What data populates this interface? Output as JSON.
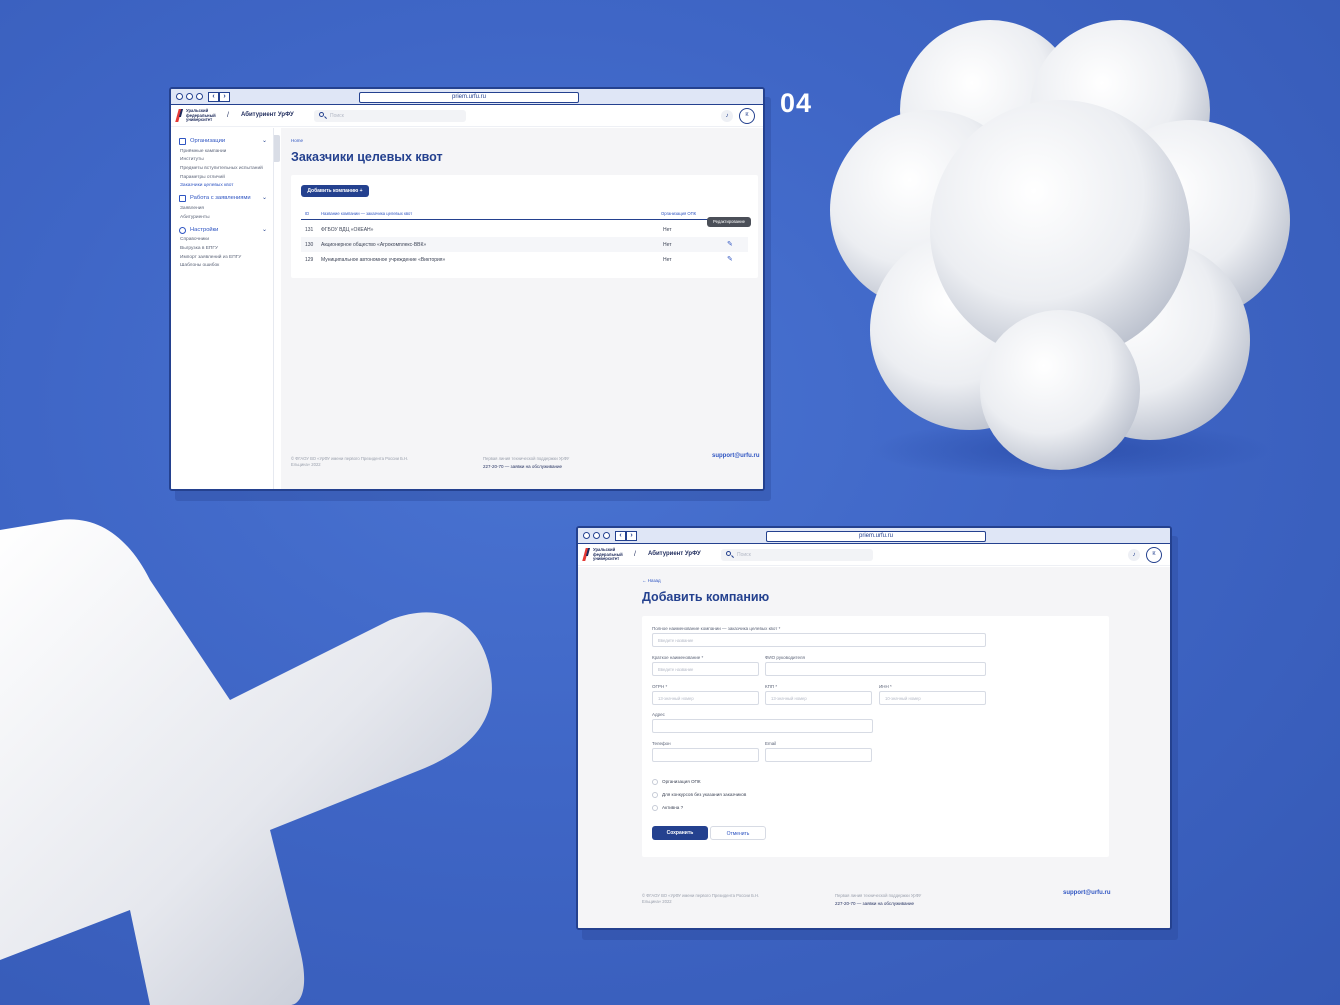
{
  "step_number": "04",
  "browser": {
    "url": "priem.urfu.ru"
  },
  "header": {
    "logo_text": "Уральский федеральный университет",
    "app_title": "Абитуриент УрФУ",
    "search_placeholder": "Поиск",
    "avatar_initial": "К"
  },
  "sidebar": {
    "groups": [
      {
        "label": "Организации",
        "icon": "building-icon",
        "items": [
          {
            "label": "Приёмные кампании",
            "active": false
          },
          {
            "label": "Институты",
            "active": false
          },
          {
            "label": "Предметы вступительных испытаний",
            "active": false
          },
          {
            "label": "Параметры отличий",
            "active": false
          },
          {
            "label": "Заказчики целевых квот",
            "active": true
          }
        ]
      },
      {
        "label": "Работа с заявлениями",
        "icon": "document-icon",
        "items": [
          {
            "label": "Заявления",
            "active": false
          },
          {
            "label": "Абитуриенты",
            "active": false
          }
        ]
      },
      {
        "label": "Настройки",
        "icon": "gear-icon",
        "items": [
          {
            "label": "Справочники",
            "active": false
          },
          {
            "label": "Выгрузка в ЕПГУ",
            "active": false
          },
          {
            "label": "Импорт заявлений из ЕПГУ",
            "active": false
          },
          {
            "label": "Шаблоны ошибок",
            "active": false
          }
        ]
      }
    ]
  },
  "list_page": {
    "breadcrumb": "Home",
    "title": "Заказчики целевых квот",
    "add_button": "Добавить компанию",
    "columns": [
      "ID",
      "Название компании — заказчика целевых квот",
      "Организация ОПК"
    ],
    "rows": [
      {
        "id": "131",
        "name": "ФГБОУ ВДЦ «ОКЕАН»",
        "opk": "Нет"
      },
      {
        "id": "130",
        "name": "Акционерное общество «Агрокомплекс-ВВК»",
        "opk": "Нет"
      },
      {
        "id": "129",
        "name": "Муниципальное автономное учреждение «Виктория»",
        "opk": "Нет"
      }
    ],
    "edit_tooltip": "Редактирование"
  },
  "form_page": {
    "back_link": "← Назад",
    "title": "Добавить компанию",
    "fields": {
      "full_name": {
        "label": "Полное наименование компании — заказчика целевых квот *",
        "placeholder": "Введите название"
      },
      "short_name": {
        "label": "Краткое наименование *",
        "placeholder": "Введите название"
      },
      "director": {
        "label": "ФИО руководителя",
        "placeholder": ""
      },
      "ogrn": {
        "label": "ОГРН *",
        "placeholder": "13-значный номер"
      },
      "kpp": {
        "label": "КПП *",
        "placeholder": "13-значный номер"
      },
      "inn": {
        "label": "ИНН *",
        "placeholder": "10-значный номер"
      },
      "address": {
        "label": "Адрес",
        "placeholder": ""
      },
      "phone": {
        "label": "Телефон",
        "placeholder": ""
      },
      "email": {
        "label": "Email",
        "placeholder": ""
      }
    },
    "options": [
      "Организация ОПК",
      "Для конкурсов без указания заказчиков",
      "Активна ?"
    ],
    "save_button": "Сохранить",
    "cancel_button": "Отменить"
  },
  "footer": {
    "copyright": "© ФГАОУ ВО «УрФУ имени первого Президента России Б.Н. Ельцина» 2022",
    "support_label": "Первая линия технической поддержки УрФУ",
    "phone": "227-20-70 — заявки на обслуживание",
    "email": "support@urfu.ru"
  },
  "colors": {
    "background": "#3f66c6",
    "primary": "#24418f",
    "accent": "#2f55c2"
  }
}
